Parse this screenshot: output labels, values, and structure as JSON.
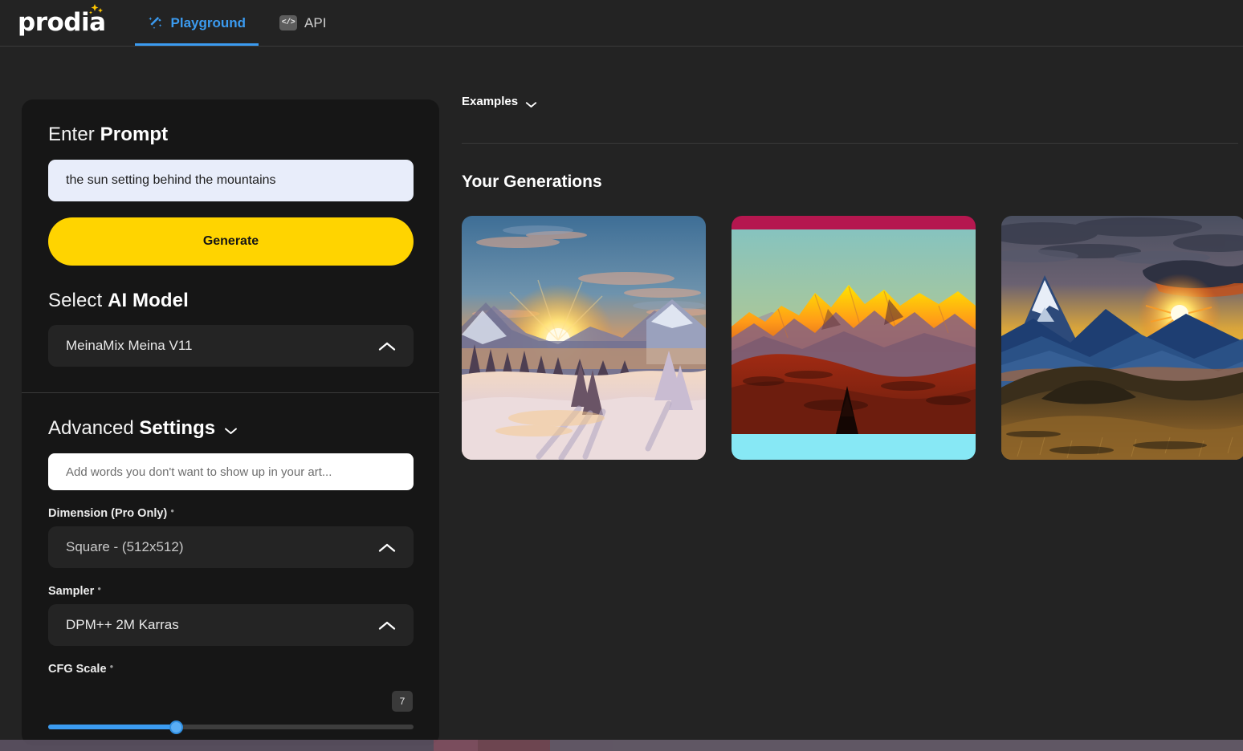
{
  "header": {
    "brand": "prodia",
    "brand_sparkle_color": "#FFC700",
    "nav": [
      {
        "label": "Playground",
        "icon": "magic-wand-icon",
        "active": true
      },
      {
        "label": "API",
        "icon": "code-brackets-icon",
        "active": false
      }
    ],
    "accent_color": "#3b9bf0"
  },
  "sidebar": {
    "prompt_section": {
      "title_light": "Enter ",
      "title_bold": "Prompt",
      "input_value": "the sun setting behind the mountains",
      "input_placeholder": "the sun setting behind the mountains",
      "generate_label": "Generate",
      "generate_color": "#FFD400"
    },
    "model_section": {
      "title_light": "Select ",
      "title_bold": "AI Model",
      "selected": "MeinaMix Meina V11",
      "chevron": "chevron-up-icon"
    },
    "advanced": {
      "title_light": "Advanced ",
      "title_bold": "Settings",
      "chevron": "chevron-down-icon",
      "negative_prompt_placeholder": "Add words you don't want to show up in your art...",
      "negative_prompt_value": "",
      "dimension_label": "Dimension (Pro Only)",
      "dimension_value": "Square - (512x512)",
      "sampler_label": "Sampler",
      "sampler_value": "DPM++ 2M Karras",
      "cfg_label": "CFG Scale",
      "cfg_value": "7",
      "cfg_percent": 35,
      "info_mark": "?"
    }
  },
  "main": {
    "examples_label": "Examples",
    "examples_chevron": "chevron-down-icon",
    "generations_title": "Your Generations",
    "generations": [
      {
        "name": "snowy-valley-sunset",
        "alt": "Snow covered valley with pine trees and a golden sun setting between mountains"
      },
      {
        "name": "alpenglow-mountain-range",
        "alt": "Golden alpenglow lit mountain range over deep red autumn hills"
      },
      {
        "name": "blue-ridge-sunburst",
        "alt": "Blue layered mountain ridges with an orange sunburst behind a dark grass hill"
      }
    ]
  }
}
